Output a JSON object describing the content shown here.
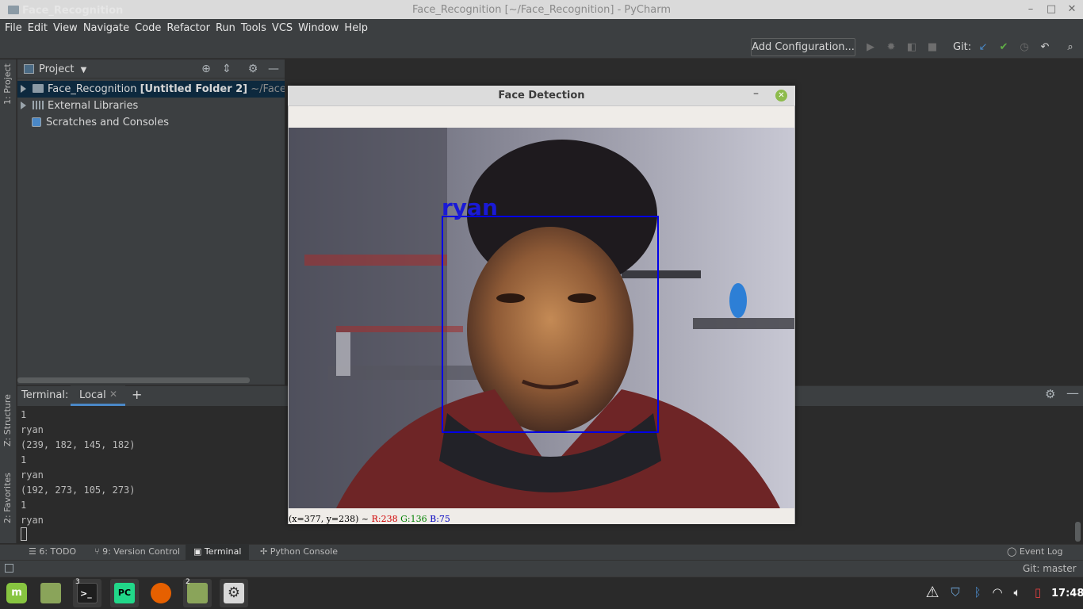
{
  "window": {
    "title": "Face_Recognition [~/Face_Recognition] - PyCharm"
  },
  "menu": [
    "File",
    "Edit",
    "View",
    "Navigate",
    "Code",
    "Refactor",
    "Run",
    "Tools",
    "VCS",
    "Window",
    "Help"
  ],
  "navbar": {
    "project_name": "Face_Recognition",
    "add_config_label": "Add Configuration...",
    "git_label": "Git:"
  },
  "left_strip": {
    "project_tab": "1: Project",
    "structure_tab": "Z: Structure",
    "favorites_tab": "2: Favorites"
  },
  "project_panel": {
    "title": "Project",
    "tree": [
      {
        "name": "Face_Recognition",
        "suffix": "[Untitled Folder 2]",
        "path": "~/Face_Reco"
      },
      {
        "name": "External Libraries"
      },
      {
        "name": "Scratches and Consoles"
      }
    ]
  },
  "terminal": {
    "title": "Terminal:",
    "tab_label": "Local",
    "lines": [
      "1",
      "ryan",
      "(239, 182, 145, 182)",
      "1",
      "ryan",
      "(192, 273, 105, 273)",
      "1",
      "ryan"
    ]
  },
  "bottom_tabs": {
    "todo": "6: TODO",
    "vcs": "9: Version Control",
    "terminal": "Terminal",
    "python_console": "Python Console",
    "event_log": "Event Log"
  },
  "status": {
    "git_branch": "Git: master"
  },
  "face_window": {
    "title": "Face Detection",
    "label": "ryan",
    "status_coords": "(x=377, y=238) ~",
    "status_r": "R:238",
    "status_g": "G:136",
    "status_b": "B:75"
  },
  "taskbar": {
    "terminal_badge": "3",
    "files_badge": "2",
    "pycharm_label": "PC",
    "clock": "17:48"
  },
  "colors": {
    "accent": "#4a88c7",
    "face_box": "#0000e6",
    "mint_green": "#87c540"
  }
}
